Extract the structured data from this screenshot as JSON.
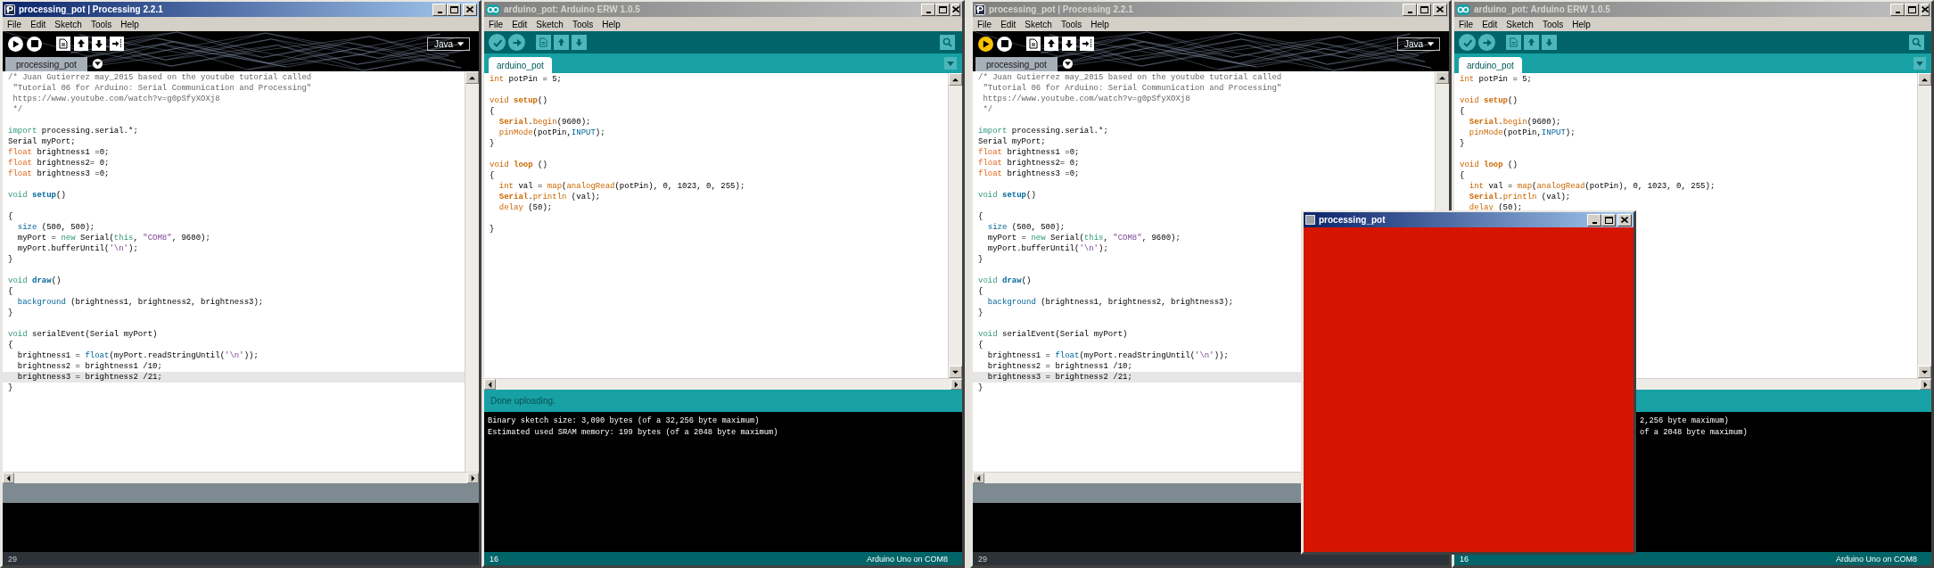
{
  "desktops": [
    {
      "windows": [
        {
          "kind": "processing",
          "active": true,
          "title": "processing_pot | Processing 2.2.1",
          "menu": [
            "File",
            "Edit",
            "Sketch",
            "Tools",
            "Help"
          ],
          "running": false,
          "mode": "Java",
          "tabs": [
            {
              "label": "processing_pot",
              "selected": true
            }
          ],
          "code": [
            {
              "highlighted": false,
              "tokens": [
                {
                  "kind": "comment",
                  "text": "/* Juan Gutierrez may_2015 based on the youtube tutorial called"
                }
              ]
            },
            {
              "highlighted": false,
              "tokens": [
                {
                  "kind": "comment",
                  "text": " \"Tutorial 06 for Arduino: Serial Communication and Processing\""
                }
              ]
            },
            {
              "highlighted": false,
              "tokens": [
                {
                  "kind": "comment",
                  "text": " https://www.youtube.com/watch?v=g0pSfyXOXj8"
                }
              ]
            },
            {
              "highlighted": false,
              "tokens": [
                {
                  "kind": "comment",
                  "text": " */"
                }
              ]
            },
            {
              "highlighted": false
            },
            {
              "highlighted": false,
              "tokens": [
                {
                  "kind": "keyword",
                  "text": "import"
                },
                " processing.serial.*;"
              ]
            },
            {
              "highlighted": false,
              "tokens": [
                "Serial myPort;"
              ]
            },
            {
              "highlighted": false,
              "tokens": [
                {
                  "kind": "type",
                  "text": "float"
                },
                " brightness1 =0;"
              ]
            },
            {
              "highlighted": false,
              "tokens": [
                {
                  "kind": "type",
                  "text": "float"
                },
                " brightness2= 0;"
              ]
            },
            {
              "highlighted": false,
              "tokens": [
                {
                  "kind": "type",
                  "text": "float"
                },
                " brightness3 =0;"
              ]
            },
            {
              "highlighted": false
            },
            {
              "highlighted": false,
              "tokens": [
                {
                  "kind": "keyword",
                  "text": "void "
                },
                {
                  "kind": "definition",
                  "text": "setup"
                },
                "()"
              ]
            },
            {
              "highlighted": false
            },
            {
              "highlighted": false,
              "tokens": [
                "{"
              ]
            },
            {
              "highlighted": false,
              "tokens": [
                {
                  "kind": "builtin",
                  "text": "  size"
                },
                " (500, 500);"
              ]
            },
            {
              "highlighted": false,
              "tokens": [
                "  myPort = ",
                {
                  "kind": "keyword",
                  "text": "new"
                },
                " Serial(",
                {
                  "kind": "keyword",
                  "text": "this"
                },
                ", ",
                {
                  "kind": "string",
                  "text": "\"COM8\""
                },
                ", 9600);"
              ]
            },
            {
              "highlighted": false,
              "tokens": [
                "  myPort.bufferUntil(",
                {
                  "kind": "string",
                  "text": "'\\n'"
                },
                ");"
              ]
            },
            {
              "highlighted": false,
              "tokens": [
                "}"
              ]
            },
            {
              "highlighted": false
            },
            {
              "highlighted": false,
              "tokens": [
                {
                  "kind": "keyword",
                  "text": "void "
                },
                {
                  "kind": "definition",
                  "text": "draw"
                },
                "()"
              ]
            },
            {
              "highlighted": false,
              "tokens": [
                "{"
              ]
            },
            {
              "highlighted": false,
              "tokens": [
                {
                  "kind": "builtin",
                  "text": "  background"
                },
                " (brightness1, brightness2, brightness3);"
              ]
            },
            {
              "highlighted": false,
              "tokens": [
                "}"
              ]
            },
            {
              "highlighted": false
            },
            {
              "highlighted": false,
              "tokens": [
                {
                  "kind": "keyword",
                  "text": "void"
                },
                " serialEvent(Serial myPort)"
              ]
            },
            {
              "highlighted": false,
              "tokens": [
                "{"
              ]
            },
            {
              "highlighted": false,
              "tokens": [
                "  brightness1 = ",
                {
                  "kind": "builtin",
                  "text": "float"
                },
                "(myPort.readStringUntil(",
                {
                  "kind": "string",
                  "text": "'\\n'"
                },
                "));"
              ]
            },
            {
              "highlighted": false,
              "tokens": [
                "  brightness2 = brightness1 /10;"
              ]
            },
            {
              "highlighted": true,
              "tokens": [
                "  brightness3 = brightness2 /21;"
              ]
            },
            {
              "highlighted": false,
              "tokens": [
                "}"
              ]
            }
          ],
          "status": "29"
        },
        {
          "kind": "arduino",
          "active": false,
          "title": "arduino_pot: Arduino ERW 1.0.5",
          "menu": [
            "File",
            "Edit",
            "Sketch",
            "Tools",
            "Help"
          ],
          "tabs": [
            {
              "label": "arduino_pot",
              "selected": true
            }
          ],
          "code": [
            {
              "highlighted": false,
              "tokens": [
                {
                  "kind": "type",
                  "text": "int"
                },
                " potPin = 5;"
              ]
            },
            {
              "highlighted": false
            },
            {
              "highlighted": false,
              "tokens": [
                {
                  "kind": "type",
                  "text": "void "
                },
                {
                  "kind": "definition",
                  "text": "setup"
                },
                "()"
              ]
            },
            {
              "highlighted": false,
              "tokens": [
                "{"
              ]
            },
            {
              "highlighted": false,
              "tokens": [
                {
                  "kind": "object",
                  "text": "  Serial"
                },
                ".",
                {
                  "kind": "builtin",
                  "text": "begin"
                },
                "(9600);"
              ]
            },
            {
              "highlighted": false,
              "tokens": [
                {
                  "kind": "builtin",
                  "text": "  pinMode"
                },
                "(potPin,",
                {
                  "kind": "constant",
                  "text": "INPUT"
                },
                ");"
              ]
            },
            {
              "highlighted": false,
              "tokens": [
                "}"
              ]
            },
            {
              "highlighted": false
            },
            {
              "highlighted": false,
              "tokens": [
                {
                  "kind": "type",
                  "text": "void "
                },
                {
                  "kind": "definition",
                  "text": "loop"
                },
                " ()"
              ]
            },
            {
              "highlighted": false,
              "tokens": [
                "{"
              ]
            },
            {
              "highlighted": false,
              "tokens": [
                {
                  "kind": "type",
                  "text": "  int"
                },
                " val = ",
                {
                  "kind": "builtin",
                  "text": "map"
                },
                "(",
                {
                  "kind": "builtin",
                  "text": "analogRead"
                },
                "(potPin), 0, 1023, 0, 255);"
              ]
            },
            {
              "highlighted": false,
              "tokens": [
                {
                  "kind": "object",
                  "text": "  Serial"
                },
                ".",
                {
                  "kind": "builtin",
                  "text": "println"
                },
                " (val);"
              ]
            },
            {
              "highlighted": false,
              "tokens": [
                {
                  "kind": "builtin",
                  "text": "  delay"
                },
                " (50);"
              ]
            },
            {
              "highlighted": false
            },
            {
              "highlighted": false,
              "tokens": [
                "}"
              ]
            }
          ],
          "message": "Done uploading.",
          "console": [
            "Binary sketch size: 3,090 bytes (of a 32,256 byte maximum)",
            "Estimated used SRAM memory: 199 bytes (of a 2048 byte maximum)"
          ],
          "status": "16",
          "board": "Arduino Uno on COM8"
        }
      ]
    },
    {
      "windows": [
        {
          "kind": "processing",
          "active": false,
          "title": "processing_pot | Processing 2.2.1",
          "menu": [
            "File",
            "Edit",
            "Sketch",
            "Tools",
            "Help"
          ],
          "running": true,
          "mode": "Java",
          "tabs": [
            {
              "label": "processing_pot",
              "selected": true
            }
          ],
          "code": [
            {
              "highlighted": false,
              "tokens": [
                {
                  "kind": "comment",
                  "text": "/* Juan Gutierrez may_2015 based on the youtube tutorial called"
                }
              ]
            },
            {
              "highlighted": false,
              "tokens": [
                {
                  "kind": "comment",
                  "text": " \"Tutorial 06 for Arduino: Serial Communication and Processing\""
                }
              ]
            },
            {
              "highlighted": false,
              "tokens": [
                {
                  "kind": "comment",
                  "text": " https://www.youtube.com/watch?v=g0pSfyXOXj8"
                }
              ]
            },
            {
              "highlighted": false,
              "tokens": [
                {
                  "kind": "comment",
                  "text": " */"
                }
              ]
            },
            {
              "highlighted": false
            },
            {
              "highlighted": false,
              "tokens": [
                {
                  "kind": "keyword",
                  "text": "import"
                },
                " processing.serial.*;"
              ]
            },
            {
              "highlighted": false,
              "tokens": [
                "Serial myPort;"
              ]
            },
            {
              "highlighted": false,
              "tokens": [
                {
                  "kind": "type",
                  "text": "float"
                },
                " brightness1 =0;"
              ]
            },
            {
              "highlighted": false,
              "tokens": [
                {
                  "kind": "type",
                  "text": "float"
                },
                " brightness2= 0;"
              ]
            },
            {
              "highlighted": false,
              "tokens": [
                {
                  "kind": "type",
                  "text": "float"
                },
                " brightness3 =0;"
              ]
            },
            {
              "highlighted": false
            },
            {
              "highlighted": false,
              "tokens": [
                {
                  "kind": "keyword",
                  "text": "void "
                },
                {
                  "kind": "definition",
                  "text": "setup"
                },
                "()"
              ]
            },
            {
              "highlighted": false
            },
            {
              "highlighted": false,
              "tokens": [
                "{"
              ]
            },
            {
              "highlighted": false,
              "tokens": [
                {
                  "kind": "builtin",
                  "text": "  size"
                },
                " (500, 500);"
              ]
            },
            {
              "highlighted": false,
              "tokens": [
                "  myPort = ",
                {
                  "kind": "keyword",
                  "text": "new"
                },
                " Serial(",
                {
                  "kind": "keyword",
                  "text": "this"
                },
                ", ",
                {
                  "kind": "string",
                  "text": "\"COM8\""
                },
                ", 9600);"
              ]
            },
            {
              "highlighted": false,
              "tokens": [
                "  myPort.bufferUntil(",
                {
                  "kind": "string",
                  "text": "'\\n'"
                },
                ");"
              ]
            },
            {
              "highlighted": false,
              "tokens": [
                "}"
              ]
            },
            {
              "highlighted": false
            },
            {
              "highlighted": false,
              "tokens": [
                {
                  "kind": "keyword",
                  "text": "void "
                },
                {
                  "kind": "definition",
                  "text": "draw"
                },
                "()"
              ]
            },
            {
              "highlighted": false,
              "tokens": [
                "{"
              ]
            },
            {
              "highlighted": false,
              "tokens": [
                {
                  "kind": "builtin",
                  "text": "  background"
                },
                " (brightness1, brightness2, brightness3);"
              ]
            },
            {
              "highlighted": false,
              "tokens": [
                "}"
              ]
            },
            {
              "highlighted": false
            },
            {
              "highlighted": false,
              "tokens": [
                {
                  "kind": "keyword",
                  "text": "void"
                },
                " serialEvent(Serial myPort)"
              ]
            },
            {
              "highlighted": false,
              "tokens": [
                "{"
              ]
            },
            {
              "highlighted": false,
              "tokens": [
                "  brightness1 = ",
                {
                  "kind": "builtin",
                  "text": "float"
                },
                "(myPort.readStringUntil(",
                {
                  "kind": "string",
                  "text": "'\\n'"
                },
                "));"
              ]
            },
            {
              "highlighted": false,
              "tokens": [
                "  brightness2 = brightness1 /10;"
              ]
            },
            {
              "highlighted": true,
              "tokens": [
                "  brightness3 = brightness2 /21;"
              ]
            },
            {
              "highlighted": false,
              "tokens": [
                "}"
              ]
            }
          ],
          "status": "29"
        },
        {
          "kind": "arduino",
          "active": false,
          "title": "arduino_pot: Arduino ERW 1.0.5",
          "menu": [
            "File",
            "Edit",
            "Sketch",
            "Tools",
            "Help"
          ],
          "tabs": [
            {
              "label": "arduino_pot",
              "selected": true
            }
          ],
          "code": [
            {
              "highlighted": false,
              "tokens": [
                {
                  "kind": "type",
                  "text": "int"
                },
                " potPin = 5;"
              ]
            },
            {
              "highlighted": false
            },
            {
              "highlighted": false,
              "tokens": [
                {
                  "kind": "type",
                  "text": "void "
                },
                {
                  "kind": "definition",
                  "text": "setup"
                },
                "()"
              ]
            },
            {
              "highlighted": false,
              "tokens": [
                "{"
              ]
            },
            {
              "highlighted": false,
              "tokens": [
                {
                  "kind": "object",
                  "text": "  Serial"
                },
                ".",
                {
                  "kind": "builtin",
                  "text": "begin"
                },
                "(9600);"
              ]
            },
            {
              "highlighted": false,
              "tokens": [
                {
                  "kind": "builtin",
                  "text": "  pinMode"
                },
                "(potPin,",
                {
                  "kind": "constant",
                  "text": "INPUT"
                },
                ");"
              ]
            },
            {
              "highlighted": false,
              "tokens": [
                "}"
              ]
            },
            {
              "highlighted": false
            },
            {
              "highlighted": false,
              "tokens": [
                {
                  "kind": "type",
                  "text": "void "
                },
                {
                  "kind": "definition",
                  "text": "loop"
                },
                " ()"
              ]
            },
            {
              "highlighted": false,
              "tokens": [
                "{"
              ]
            },
            {
              "highlighted": false,
              "tokens": [
                {
                  "kind": "type",
                  "text": "  int"
                },
                " val = ",
                {
                  "kind": "builtin",
                  "text": "map"
                },
                "(",
                {
                  "kind": "builtin",
                  "text": "analogRead"
                },
                "(potPin), 0, 1023, 0, 255);"
              ]
            },
            {
              "highlighted": false,
              "tokens": [
                {
                  "kind": "object",
                  "text": "  Serial"
                },
                ".",
                {
                  "kind": "builtin",
                  "text": "println"
                },
                " (val);"
              ]
            },
            {
              "highlighted": false,
              "tokens": [
                {
                  "kind": "builtin",
                  "text": "  delay"
                },
                " (50);"
              ]
            }
          ],
          "console": [
            "2,256 byte maximum)",
            "of a 2048 byte maximum)"
          ],
          "status": "16",
          "board": "Arduino Uno on COM8"
        },
        {
          "kind": "sketch",
          "active": true,
          "title": "processing_pot"
        }
      ]
    }
  ]
}
